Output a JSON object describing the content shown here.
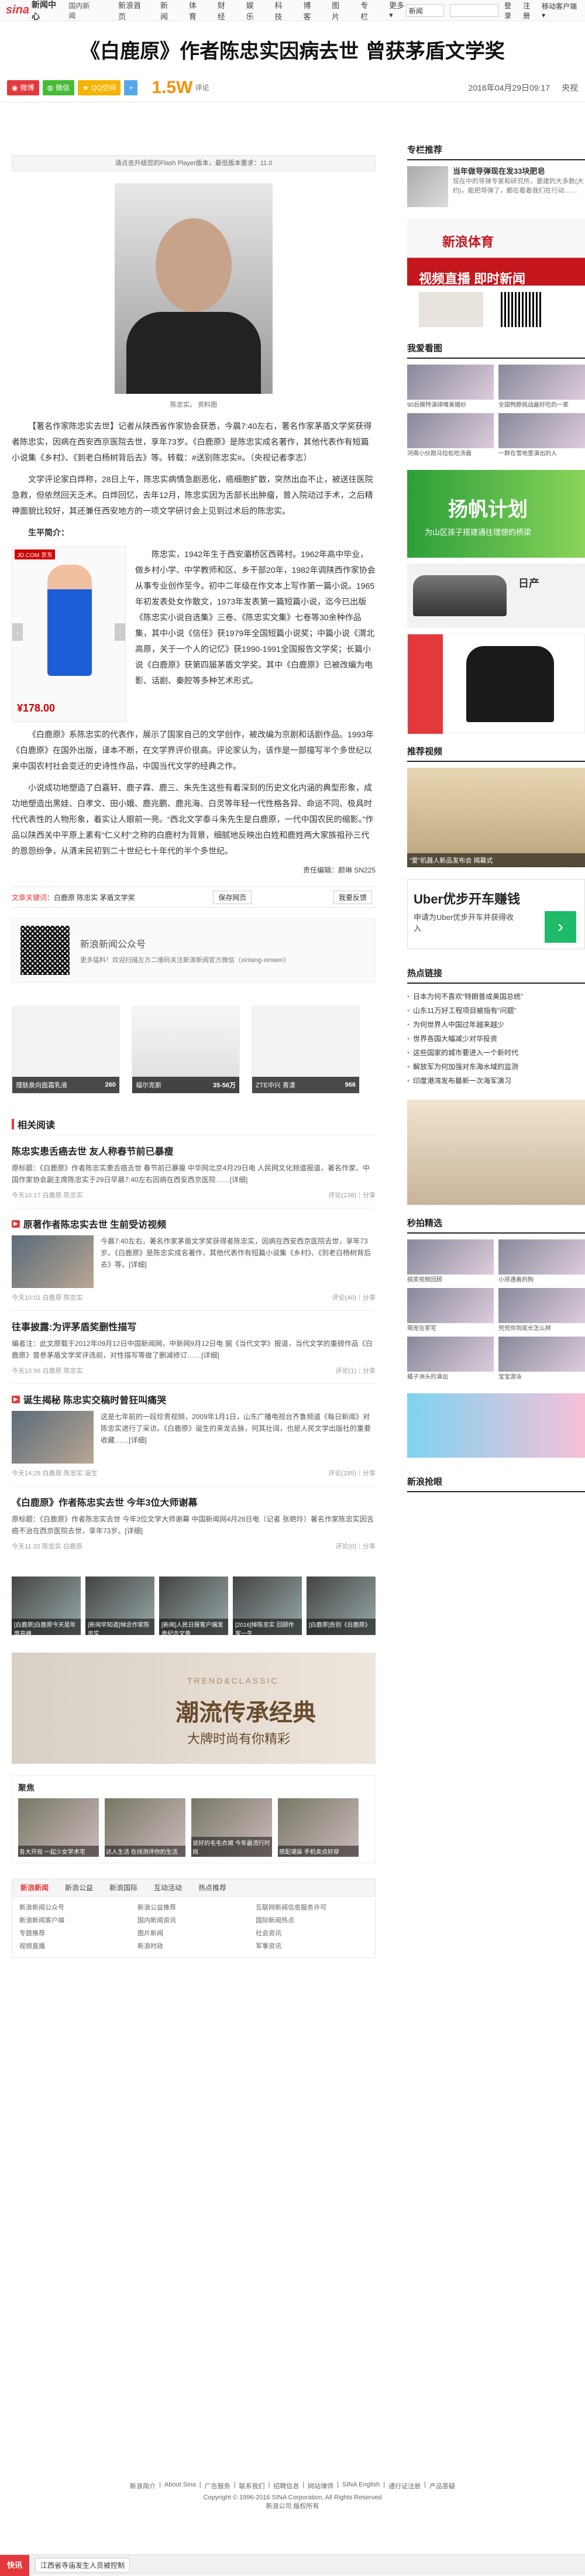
{
  "topnav": {
    "logo_text": "sina",
    "logo_sub": "新闻中心",
    "crumb": "国内新闻",
    "links": [
      "新浪首页",
      "新闻",
      "体育",
      "财经",
      "娱乐",
      "科技",
      "博客",
      "图片",
      "专栏",
      "更多▾"
    ],
    "select_value": "新闻",
    "login": "登录",
    "register": "注册",
    "mobile": "移动客户端 ▾"
  },
  "article": {
    "title": "《白鹿原》作者陈忠实因病去世 曾获茅盾文学奖",
    "share": {
      "weibo": "微博",
      "wechat": "微信",
      "qzone": "QQ空间",
      "more": "+",
      "count": "1.5W",
      "count_label": "评论"
    },
    "date": "2016年04月29日09:17",
    "source": "央视",
    "flash_notice": "请点击升级您的Flash Player版本，最低版本要求：11.0",
    "photo_caption": "陈忠实。 资料图",
    "paragraphs": [
      "【著名作家陈忠实去世】记者从陕西省作家协会获悉，今晨7:40左右，著名作家茅盾文学奖获得者陈忠实，因病在西安西京医院去世，享年73岁。《白鹿原》是陈忠实成名著作，其他代表作有短篇小说集《乡村》、《到老白杨树背后去》等。转载：#送别陈忠实#。（央视记者李志）",
      "文学评论家白烨称，28日上午，陈忠实病情急剧恶化，癌细胞扩散，突然出血不止，被送往医院急救，但依然回天乏术。白烨回忆，去年12月，陈忠实因为舌部长出肿瘤，曾入院动过手术，之后精神面貌比较好，其还兼任西安地方的一项文学研讨会上见到过术后的陈忠实。"
    ],
    "subheading": "生平简介：",
    "bio_paragraphs": [
      "陈忠实，1942年生于西安灞桥区西蒋村。1962年高中毕业，做乡村小学、中学教师和区、乡干部20年，1982年调陕西作家协会从事专业创作至今。初中二年级在作文本上写作第一篇小说。1965年初发表处女作散文，1973年发表第一篇短篇小说，迄今已出版《陈忠实小说自选集》三卷、《陈忠实文集》七卷等30余种作品集，其中小说《信任》获1979年全国短篇小说奖；中篇小说《渭北高原，关于一个人的记忆》获1990-1991全国报告文学奖；长篇小说《白鹿原》获第四届茅盾文学奖。其中《白鹿原》已被改编为电影、话剧、秦腔等多种艺术形式。",
      "《白鹿原》系陈忠实的代表作，展示了国家自己的文学创作，被改编为京剧和话剧作品。1993年《白鹿原》在国外出版，译本不断，在文学界评价很高。评论家认为，该作是一部描写半个多世纪以来中国农村社会变迁的史诗性作品，中国当代文学的经典之作。",
      "小说成功地塑造了白嘉轩、鹿子霖、鹿三、朱先生这些有着深刻的历史文化内涵的典型形象，成功地塑造出黑娃、白孝文、田小娥、鹿兆鹏、鹿兆海、白灵等年轻一代性格各异、命运不同、极具时代代表性的人物形象，着实让人眼前一亮。“西北文学泰斗朱先生是白鹿原，一代中国农民的缩影。”作品以陕西关中平原上素有“仁义村”之称的白鹿村为背景，细腻地反映出白姓和鹿姓两大家族祖孙三代的恩怨纷争，从清末民初到二十世纪七十年代的半个多世纪。"
    ],
    "ad_price": "¥178.00",
    "ad_tag": "JD.COM 京东",
    "editor": "责任编辑：颜琳 SN225",
    "keywords_label": "文章关键词：",
    "keywords": "白鹿原 陈忠实 茅盾文学奖",
    "save_btn": "保存网页",
    "report_btn": "我要反馈"
  },
  "qrpromo": {
    "title": "新浪新闻公众号",
    "desc": "更多猛料！欢迎扫描左方二维码关注新浪新闻官方微信（xinlang-xinwen）"
  },
  "products": [
    {
      "name": "理肤泉向面霜乳液",
      "price": "260"
    },
    {
      "name": "福尔克斯",
      "price": "35-56万"
    },
    {
      "name": "ZTE中兴 青漾",
      "price": "966"
    }
  ],
  "related": {
    "title": "相关阅读",
    "items": [
      {
        "title": "陈忠实患舌癌去世 友人称春节前已暴瘦",
        "summary": "原标题：《白鹿原》作者陈忠实患舌癌去世 春节前已暴瘦 中华网北京4月29日电 人民网文化频道报道，著名作家、中国作家协会副主席陈忠实于29日早晨7:40左右因病在西安西京医院……[详细]",
        "meta": "今天10:17 白鹿原 陈忠实",
        "comments": "评论(238)｜分享",
        "video": false
      },
      {
        "title": "原著作者陈忠实去世 生前受访视频",
        "summary": "今晨7:40左右，著名作家茅盾文学奖获得者陈忠实，因病在西安西京医院去世，享年73岁。《白鹿原》是陈忠实成名著作，其他代表作有短篇小说集《乡村》、《到老白杨树背后去》等。[详细]",
        "meta": "今天10:01 白鹿原 陈忠实",
        "comments": "评论(40)｜分享",
        "video": true
      },
      {
        "title": "往事披露:为评茅盾奖删性描写",
        "summary": "编者注：此文原载于2012年09月12日中国新闻网，中新网9月12日电 据《当代文学》报道，当代文学的重磅作品《白鹿原》曾参茅盾文学奖评选前，对性描写等做了删减修订……[详细]",
        "meta": "今天10:56 白鹿原 陈忠实",
        "comments": "评论(1)｜分享",
        "video": false
      },
      {
        "title": "诞生揭秘 陈忠实交稿时曾狂叫痛哭",
        "summary": "这是七年前的一段珍贵视频，2009年1月1日，山东广播电视台齐鲁频道《每日新闻》对陈忠实进行了采访。《白鹿原》诞生的来龙去脉，何其壮阔，也是人民文学出版社的重要收藏……[详细]",
        "meta": "今天14:28 白鹿原 陈忠实 诞生",
        "comments": "评论(195)｜分享",
        "video": true
      },
      {
        "title": "《白鹿原》作者陈忠实去世 今年3位大师谢幕",
        "summary": "原标题：《白鹿原》作者陈忠实去世 今年3位文学大师谢幕 中国新闻网4月28日电（记者 张艳玲）著名作家陈忠实因舌癌不治在西京医院去世，享年73岁。[详细]",
        "meta": "今天11:32 陈忠实 白鹿原",
        "comments": "评论(0)｜分享",
        "video": false
      }
    ]
  },
  "video_thumbs": [
    "[白鹿原]白鹿原今天是年度高峰",
    "[新闻早知道]悼念作家陈忠实",
    "[新闻]人民日报客户端发表纪念文章",
    "[2016]悼陈忠实 回顾作家一生",
    "[白鹿原]告别《白鹿原》"
  ],
  "trend": {
    "eyebrow": "TREND&CLASSIC",
    "headline": "潮流传承经典",
    "sub": "大牌时尚有你精彩"
  },
  "fun": {
    "title": "聚焦",
    "items": [
      "各大开局 一起少女学术宅",
      "达人生活 在线测评你的生活",
      "说好的毛毛衣裙 今年最流行时尚",
      "搭配潮装 手机卖点好穿"
    ]
  },
  "links": {
    "tabs": [
      "新浪新闻",
      "新浪公益",
      "新浪国际",
      "互动活动",
      "热点推荐"
    ],
    "items": [
      "新浪新闻公众号",
      "新浪公益推荐",
      "互联网新闻信息服务许可",
      "新浪新闻客户端",
      "国内新闻资讯",
      "国际新闻热点",
      "专题推荐",
      "图片新闻",
      "社会资讯",
      "视频直播",
      "新浪时政",
      "军事资讯"
    ]
  },
  "sidebar": {
    "column_title": "专栏推荐",
    "column_item": "当年做导弹现在发33块肥皂",
    "column_desc": "现在中的导弹专家和研究所，要建的大多数(大约)，能把导弹了，都在看着我们在行动……",
    "ad_sports": "新浪体育",
    "live_banner": "视频直播 即时新闻",
    "pics_title": "我爱看图",
    "pics": [
      "90后模特演绎唯美婚纱",
      "全国鸭脖挑战最好吃的一家",
      "河南小伙跑马拉松吃汤面",
      "一群在雪地里演出的人"
    ],
    "promo1": "扬帆计划",
    "promo1_sub": "为山区孩子搭建通往理想的桥梁",
    "brand": "日产",
    "recvideo_title": "推荐视频",
    "recvideo_caption": "“爱”机器人新品发布会 揭幕式",
    "uber_title": "Uber优步开车赚钱",
    "uber_sub": "申请为Uber优步开车并获得收入",
    "hot_title": "热点链接",
    "hot": [
      "日本为何不喜欢“特朗普成美国总统”",
      "山东11万好工程项目被指有“问题”",
      "为何世界人中国过年越来越少",
      "世界各国大幅减少对华投资",
      "这些国家的城市要进入一个新时代",
      "解放军为何加强对东海水域的监测",
      "印度港湾发布最新一次海军演习"
    ],
    "shop_title": "秒拍精选",
    "shop_items": [
      "搞笑视频回顾",
      "小孩遇着的狗",
      "萌宠在家宅",
      "兜兜你到底长怎么样",
      "橘子洲头的演出",
      "宝宝游泳"
    ],
    "bottom_title": "新浪抢眼",
    "bottom_sub": "新浪抢眼"
  },
  "footer": {
    "links": [
      "新浪简介",
      "About Sina",
      "广告服务",
      "联系我们",
      "招聘信息",
      "网站律师",
      "SINA English",
      "通行证注册",
      "产品答疑"
    ],
    "copyright": "Copyright © 1996-2016 SINA Corporation, All Rights Reserved",
    "company": "新浪公司 版权所有"
  },
  "bottombar": {
    "tag": "快讯",
    "text": "江西省寺庙发生人员被控制"
  }
}
